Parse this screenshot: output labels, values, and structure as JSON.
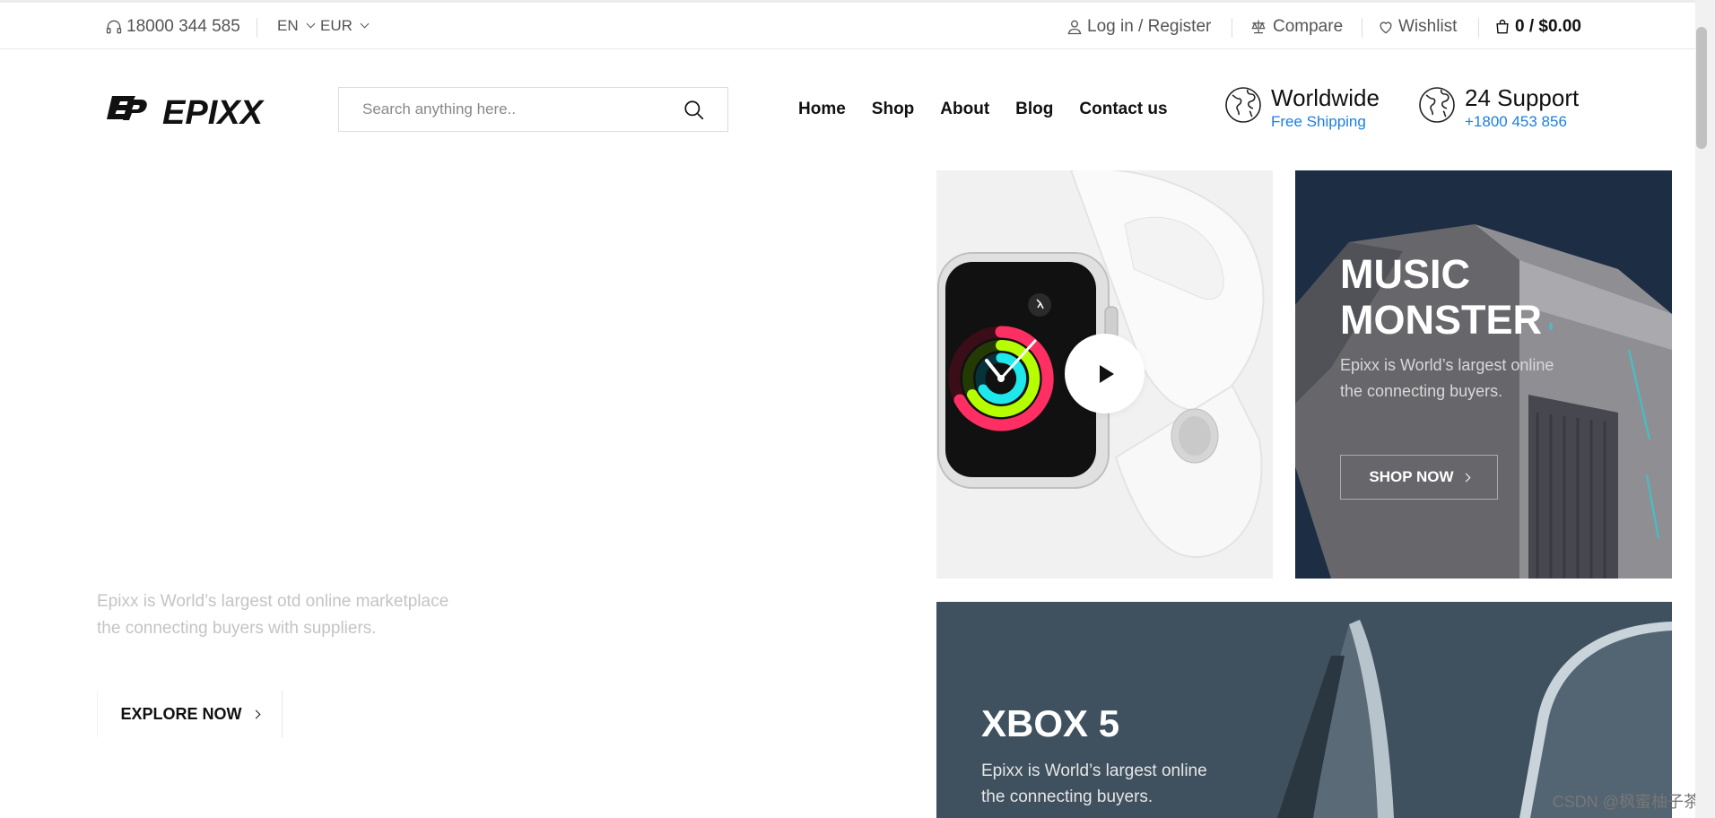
{
  "topbar": {
    "phone": "18000 344 585",
    "language": "EN",
    "currency": "EUR",
    "login": "Log in / Register",
    "compare": "Compare",
    "wishlist": "Wishlist",
    "cart": "0 / $0.00"
  },
  "header": {
    "logo_text": "EPIXX",
    "search_placeholder": "Search anything here..",
    "nav": [
      "Home",
      "Shop",
      "About",
      "Blog",
      "Contact us"
    ],
    "features": [
      {
        "title": "Worldwide",
        "subtitle": "Free Shipping"
      },
      {
        "title": "24 Support",
        "subtitle": "+1800 453 856"
      }
    ]
  },
  "hero": {
    "description_line1": "Epixx is World’s largest otd online marketplace",
    "description_line2": "the connecting buyers with suppliers.",
    "button": "EXPLORE NOW"
  },
  "banners": {
    "music": {
      "title_line1": "MUSIC",
      "title_line2": "MONSTER",
      "desc_line1": "Epixx is World’s largest online",
      "desc_line2": "the connecting buyers.",
      "button": "SHOP NOW"
    },
    "xbox": {
      "title": "XBOX 5",
      "desc_line1": "Epixx is World’s largest online",
      "desc_line2": "the connecting buyers."
    }
  },
  "watermark": "CSDN @枫蜜柚子茶",
  "colors": {
    "accent_blue": "#1b7fe0",
    "music_bg": "#1e2f45",
    "xbox_bg": "#3f505e",
    "watch_bg": "#f1f1f1"
  }
}
